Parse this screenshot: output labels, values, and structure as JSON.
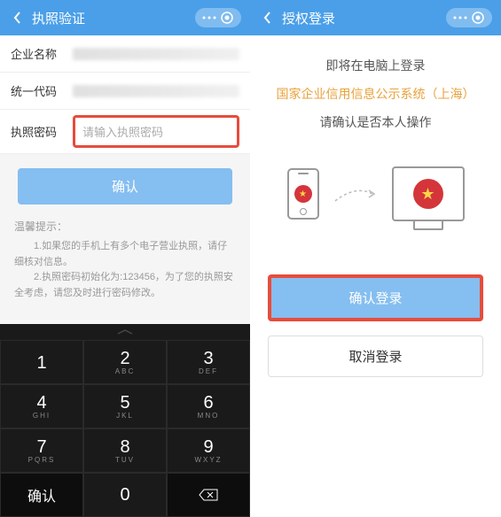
{
  "left": {
    "header": {
      "title": "执照验证"
    },
    "fields": {
      "companyName": {
        "label": "企业名称"
      },
      "unifiedCode": {
        "label": "统一代码"
      },
      "password": {
        "label": "执照密码",
        "placeholder": "请输入执照密码"
      }
    },
    "confirmBtn": "确认",
    "hint": {
      "title": "温馨提示：",
      "line1": "1.如果您的手机上有多个电子营业执照，请仔细核对信息。",
      "line2": "2.执照密码初始化为:123456，为了您的执照安全考虑，请您及时进行密码修改。"
    },
    "keypad": {
      "keys": [
        {
          "num": "1",
          "sub": ""
        },
        {
          "num": "2",
          "sub": "ABC"
        },
        {
          "num": "3",
          "sub": "DEF"
        },
        {
          "num": "4",
          "sub": "GHI"
        },
        {
          "num": "5",
          "sub": "JKL"
        },
        {
          "num": "6",
          "sub": "MNO"
        },
        {
          "num": "7",
          "sub": "PQRS"
        },
        {
          "num": "8",
          "sub": "TUV"
        },
        {
          "num": "9",
          "sub": "WXYZ"
        }
      ],
      "zero": "0",
      "confirm": "确认",
      "backspace": "⌫"
    }
  },
  "right": {
    "header": {
      "title": "授权登录"
    },
    "line1": "即将在电脑上登录",
    "line2": "国家企业信用信息公示系统（上海）",
    "line3": "请确认是否本人操作",
    "confirmBtn": "确认登录",
    "cancelBtn": "取消登录"
  }
}
